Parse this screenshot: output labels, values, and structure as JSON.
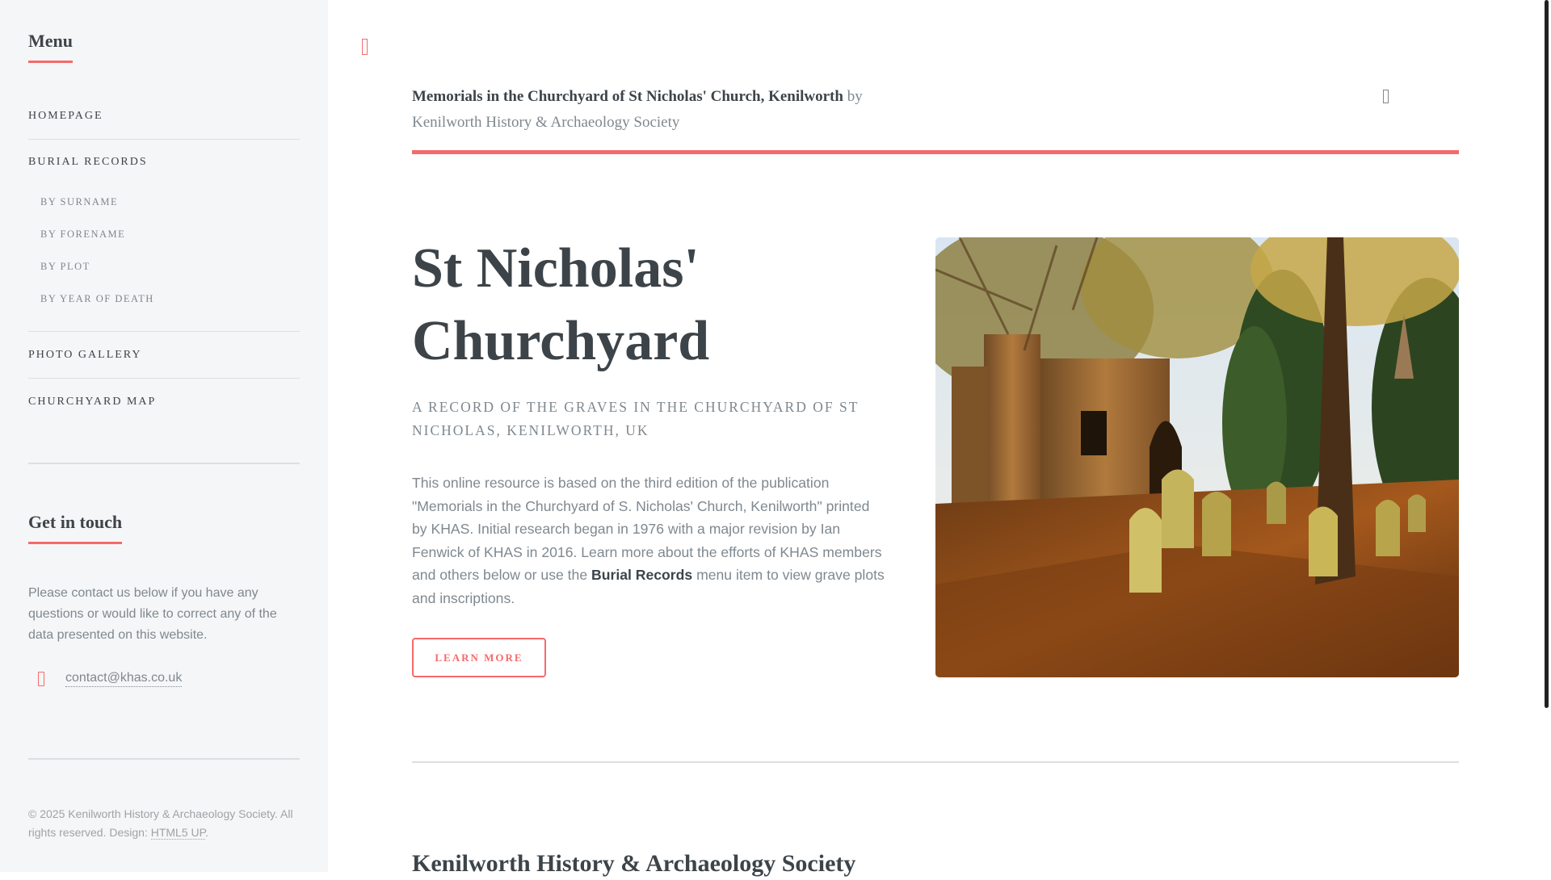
{
  "sidebar": {
    "menu_heading": "Menu",
    "items": [
      {
        "label": "Homepage"
      },
      {
        "label": "Burial Records",
        "children": [
          {
            "label": "By Surname"
          },
          {
            "label": "By Forename"
          },
          {
            "label": "By Plot"
          },
          {
            "label": "By Year of Death"
          }
        ]
      },
      {
        "label": "Photo Gallery"
      },
      {
        "label": "Churchyard Map"
      }
    ],
    "contact_heading": "Get in touch",
    "contact_text": "Please contact us below if you have any questions or would like to correct any of the data presented on this website.",
    "contact_email": "contact@khas.co.uk",
    "footer_text": "© 2025 Kenilworth History & Archaeology Society. All rights reserved. Design: ",
    "footer_link": "HTML5 UP",
    "footer_end": "."
  },
  "header": {
    "title_strong": "Memorials in the Churchyard of St Nicholas' Church, Kenilworth",
    "title_by": " by ",
    "title_org": "Kenilworth History & Archaeology Society"
  },
  "banner": {
    "title_line1": "St Nicholas'",
    "title_line2": "Churchyard",
    "subtitle": "A record of the graves in the churchyard of St Nicholas, Kenilworth, UK",
    "body_before": "This online resource is based on the third edition of the publication \"Memorials in the Churchyard of S. Nicholas' Church, Kenilworth\" printed by KHAS. Initial research began in 1976 with a major revision by Ian Fenwick of KHAS in 2016. Learn more about the efforts of KHAS members and others below or use the ",
    "body_strong": "Burial Records",
    "body_after": " menu item to view grave plots and inscriptions.",
    "button_label": "Learn More"
  },
  "section": {
    "title": "Kenilworth History & Archaeology Society"
  },
  "icons": {
    "toggle": "menu-toggle-icon",
    "header": "facebook-icon",
    "email": "envelope-icon"
  },
  "colors": {
    "accent": "#f56a6a",
    "heading": "#3d4449",
    "text": "#7f888f",
    "sidebar_bg": "#f5f6f7"
  }
}
